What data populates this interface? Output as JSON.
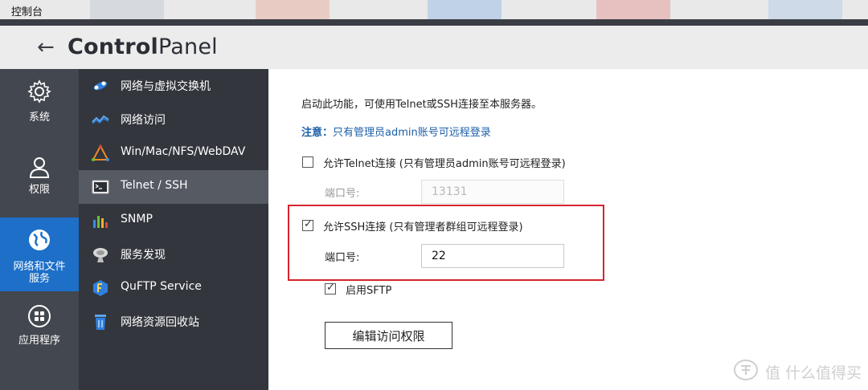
{
  "window": {
    "title": "控制台"
  },
  "header": {
    "back_icon": "back-arrow-icon",
    "title_bold": "Control",
    "title_light": "Panel"
  },
  "left_nav": [
    {
      "label": "系统",
      "icon": "gear-icon"
    },
    {
      "label": "权限",
      "icon": "user-icon"
    },
    {
      "label_line1": "网络和文件",
      "label_line2": "服务",
      "icon": "globe-icon",
      "active": true
    },
    {
      "label": "应用程序",
      "icon": "apps-grid-icon"
    }
  ],
  "sub_nav": [
    {
      "label": "网络与虚拟交换机",
      "icon": "network-switch-icon"
    },
    {
      "label": "网络访问",
      "icon": "network-access-icon"
    },
    {
      "label": "Win/Mac/NFS/WebDAV",
      "icon": "file-sharing-icon"
    },
    {
      "label": "Telnet / SSH",
      "icon": "terminal-icon",
      "active": true
    },
    {
      "label": "SNMP",
      "icon": "bar-chart-icon"
    },
    {
      "label": "服务发现",
      "icon": "satellite-dish-icon"
    },
    {
      "label": "QuFTP Service",
      "icon": "ftp-icon"
    },
    {
      "label": "网络资源回收站",
      "icon": "recycle-bin-icon"
    }
  ],
  "content": {
    "description": "启动此功能，可使用Telnet或SSH连接至本服务器。",
    "note_label": "注意：",
    "note_text": "只有管理员admin账号可远程登录",
    "telnet": {
      "label": "允许Telnet连接 (只有管理员admin账号可远程登录)",
      "checked": false,
      "port_label": "端口号:",
      "port_value": "13131"
    },
    "ssh": {
      "label": "允许SSH连接 (只有管理者群组可远程登录)",
      "checked": true,
      "port_label": "端口号:",
      "port_value": "22"
    },
    "sftp": {
      "label": "启用SFTP",
      "checked": true
    },
    "edit_button": "编辑访问权限"
  },
  "watermark": {
    "text": "值 什么值得买"
  },
  "colors": {
    "accent": "#1d6fc8",
    "highlight_box": "#d6242d",
    "note": "#1d5fa8"
  }
}
